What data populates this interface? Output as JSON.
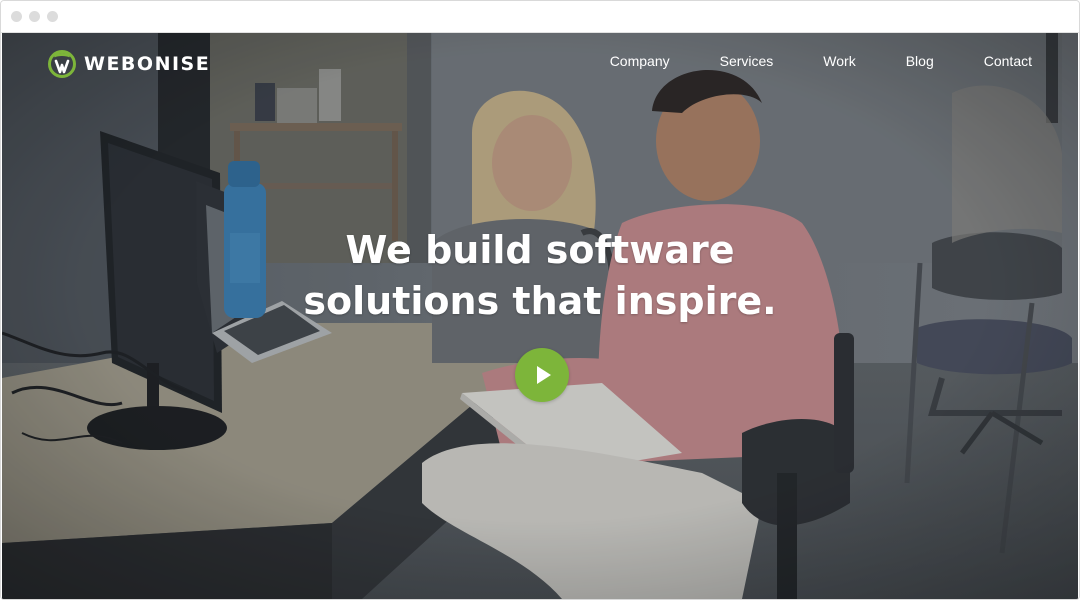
{
  "brand": {
    "name": "WEBONISE",
    "accent": "#7db53a"
  },
  "nav": {
    "items": [
      {
        "label": "Company"
      },
      {
        "label": "Services"
      },
      {
        "label": "Work"
      },
      {
        "label": "Blog"
      },
      {
        "label": "Contact"
      }
    ]
  },
  "hero": {
    "headline_line1": "We build software",
    "headline_line2": "solutions that inspire.",
    "play_icon": "play-icon"
  }
}
